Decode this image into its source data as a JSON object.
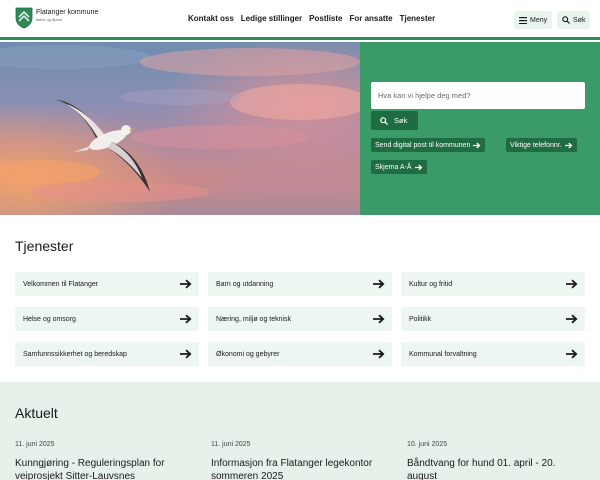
{
  "header": {
    "logo_name": "Flatanger kommune",
    "logo_sub": "aktivt og åpent",
    "nav": [
      "Kontakt oss",
      "Ledige stillinger",
      "Postliste",
      "For ansatte",
      "Tjenester"
    ],
    "menu_label": "Meny",
    "search_label": "Søk"
  },
  "hero": {
    "image": "sunset-sky-with-seagull",
    "search_placeholder": "Hva kan vi hjelpe deg med?",
    "search_button": "Søk",
    "quick_links": [
      "Send digital post til kommunen",
      "Viktige telefonnr.",
      "Skjema A-Å"
    ]
  },
  "services": {
    "title": "Tjenester",
    "items": [
      "Velkommen til Flatanger",
      "Barn og utdanning",
      "Kultur og fritid",
      "Helse og omsorg",
      "Næring, miljø og teknisk",
      "Politikk",
      "Samfunnssikkerhet og beredskap",
      "Økonomi og gebyrer",
      "Kommunal forvaltning"
    ]
  },
  "news": {
    "title": "Aktuelt",
    "items": [
      {
        "date": "11. juni 2025",
        "title": "Kunngjøring - Reguleringsplan for veiprosjekt Sitter-Lauvsnes"
      },
      {
        "date": "11. juni 2025",
        "title": "Informasjon fra Flatanger legekontor sommeren 2025"
      },
      {
        "date": "10. juni 2025",
        "title": "Båndtvang for hund 01. april - 20. august"
      }
    ]
  },
  "colors": {
    "brand_green": "#3a9a68",
    "dark_green": "#1f6b42",
    "light_green": "#eef6f1",
    "news_bg": "#e6f1ea"
  }
}
